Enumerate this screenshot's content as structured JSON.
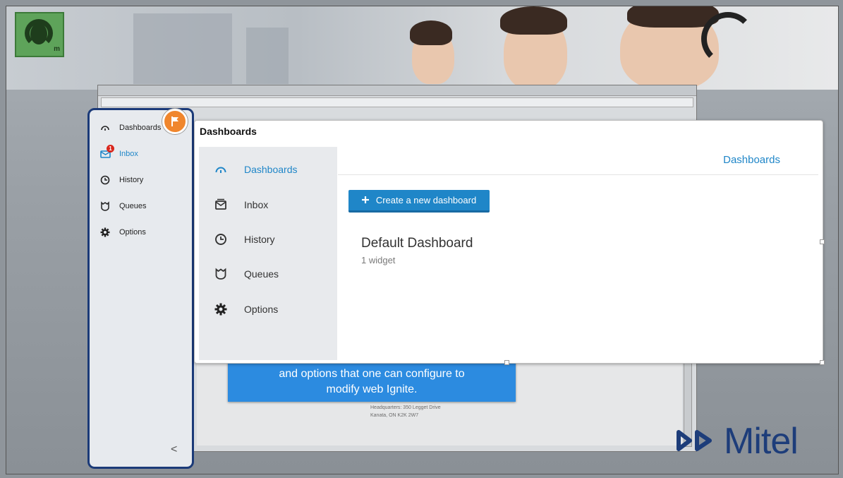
{
  "colors": {
    "accent": "#1f86c8",
    "sidebar_border": "#1b3a78",
    "flag": "#f0862d",
    "tooltip": "#2c8be0",
    "badge": "#d9261c",
    "brand": "#1d3d7a"
  },
  "sidebar": {
    "items": [
      {
        "label": "Dashboards",
        "icon": "dashboard-icon"
      },
      {
        "label": "Inbox",
        "icon": "inbox-icon",
        "badge": "1"
      },
      {
        "label": "History",
        "icon": "clock-icon"
      },
      {
        "label": "Queues",
        "icon": "queue-icon"
      },
      {
        "label": "Options",
        "icon": "gear-icon"
      }
    ],
    "collapse_glyph": "<"
  },
  "panel": {
    "title": "Dashboards",
    "header_label": "Dashboards",
    "nav": [
      {
        "label": "Dashboards",
        "icon": "dashboard-icon"
      },
      {
        "label": "Inbox",
        "icon": "inbox-icon"
      },
      {
        "label": "History",
        "icon": "clock-icon"
      },
      {
        "label": "Queues",
        "icon": "queue-icon"
      },
      {
        "label": "Options",
        "icon": "gear-icon"
      }
    ],
    "create_button": "Create a new dashboard",
    "dashboard": {
      "name": "Default Dashboard",
      "subtitle": "1 widget"
    }
  },
  "tooltip": {
    "line1": "and options that one can configure to",
    "line2": "modify web Ignite."
  },
  "background_address": {
    "line1": "Headquarters: 350 Legget Drive",
    "line2": "Kanata, ON K2K 2W7"
  },
  "brand": {
    "name": "Mitel"
  }
}
